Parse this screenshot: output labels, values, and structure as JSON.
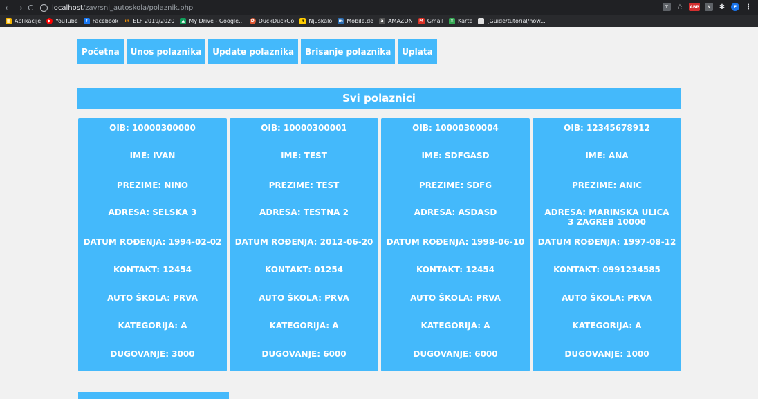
{
  "browser": {
    "url_host": "localhost",
    "url_path": "/zavrsni_autoskola/polaznik.php",
    "bookmarks": [
      {
        "label": "Aplikacije",
        "icon": "apps-icon",
        "color": "#f4b400"
      },
      {
        "label": "YouTube",
        "icon": "youtube-icon",
        "color": "#ff0000"
      },
      {
        "label": "Facebook",
        "icon": "facebook-icon",
        "color": "#1877f2"
      },
      {
        "label": "ELF 2019/2020",
        "icon": "elf-icon",
        "color": "#ff9800"
      },
      {
        "label": "My Drive - Google...",
        "icon": "drive-icon",
        "color": "#0f9d58"
      },
      {
        "label": "DuckDuckGo",
        "icon": "duckduckgo-icon",
        "color": "#de5833"
      },
      {
        "label": "Njuskalo",
        "icon": "njuskalo-icon",
        "color": "#ffcc00"
      },
      {
        "label": "Mobile.de",
        "icon": "mobilede-icon",
        "color": "#2b6cb0"
      },
      {
        "label": "AMAZON",
        "icon": "amazon-icon",
        "color": "#555555"
      },
      {
        "label": "Gmail",
        "icon": "gmail-icon",
        "color": "#d93025"
      },
      {
        "label": "Karte",
        "icon": "maps-icon",
        "color": "#34a853"
      },
      {
        "label": "[Guide/tutorial/how...",
        "icon": "guide-icon",
        "color": "#e0e0e0"
      }
    ]
  },
  "menu": [
    {
      "label": "Početna"
    },
    {
      "label": "Unos polaznika"
    },
    {
      "label": "Update polaznika"
    },
    {
      "label": "Brisanje polaznika"
    },
    {
      "label": "Uplata"
    }
  ],
  "section_title": "Svi polaznici",
  "accent_color": "#44b9fb",
  "students": [
    {
      "oib": "OIB: 10000300000",
      "ime": "IME: IVAN",
      "prezime": "PREZIME: NINO",
      "adresa": "ADRESA: SELSKA 3",
      "datum": "DATUM ROĐENJA: 1994-02-02",
      "kontakt": "KONTAKT: 12454",
      "skola": "AUTO ŠKOLA: PRVA",
      "kategorija": "KATEGORIJA: A",
      "dugovanje": "DUGOVANJE: 3000"
    },
    {
      "oib": "OIB: 10000300001",
      "ime": "IME: TEST",
      "prezime": "PREZIME: TEST",
      "adresa": "ADRESA: TESTNA 2",
      "datum": "DATUM ROĐENJA: 2012-06-20",
      "kontakt": "KONTAKT: 01254",
      "skola": "AUTO ŠKOLA: PRVA",
      "kategorija": "KATEGORIJA: A",
      "dugovanje": "DUGOVANJE: 6000"
    },
    {
      "oib": "OIB: 10000300004",
      "ime": "IME: SDFGASD",
      "prezime": "PREZIME: SDFG",
      "adresa": "ADRESA: ASDASD",
      "datum": "DATUM ROĐENJA: 1998-06-10",
      "kontakt": "KONTAKT: 12454",
      "skola": "AUTO ŠKOLA: PRVA",
      "kategorija": "KATEGORIJA: A",
      "dugovanje": "DUGOVANJE: 6000"
    },
    {
      "oib": "OIB: 12345678912",
      "ime": "IME: ANA",
      "prezime": "PREZIME: ANIC",
      "adresa": "ADRESA: MARINSKA ULICA 3 ZAGREB 10000",
      "datum": "DATUM ROĐENJA: 1997-08-12",
      "kontakt": "KONTAKT: 0991234585",
      "skola": "AUTO ŠKOLA: PRVA",
      "kategorija": "KATEGORIJA: A",
      "dugovanje": "DUGOVANJE: 1000"
    }
  ]
}
